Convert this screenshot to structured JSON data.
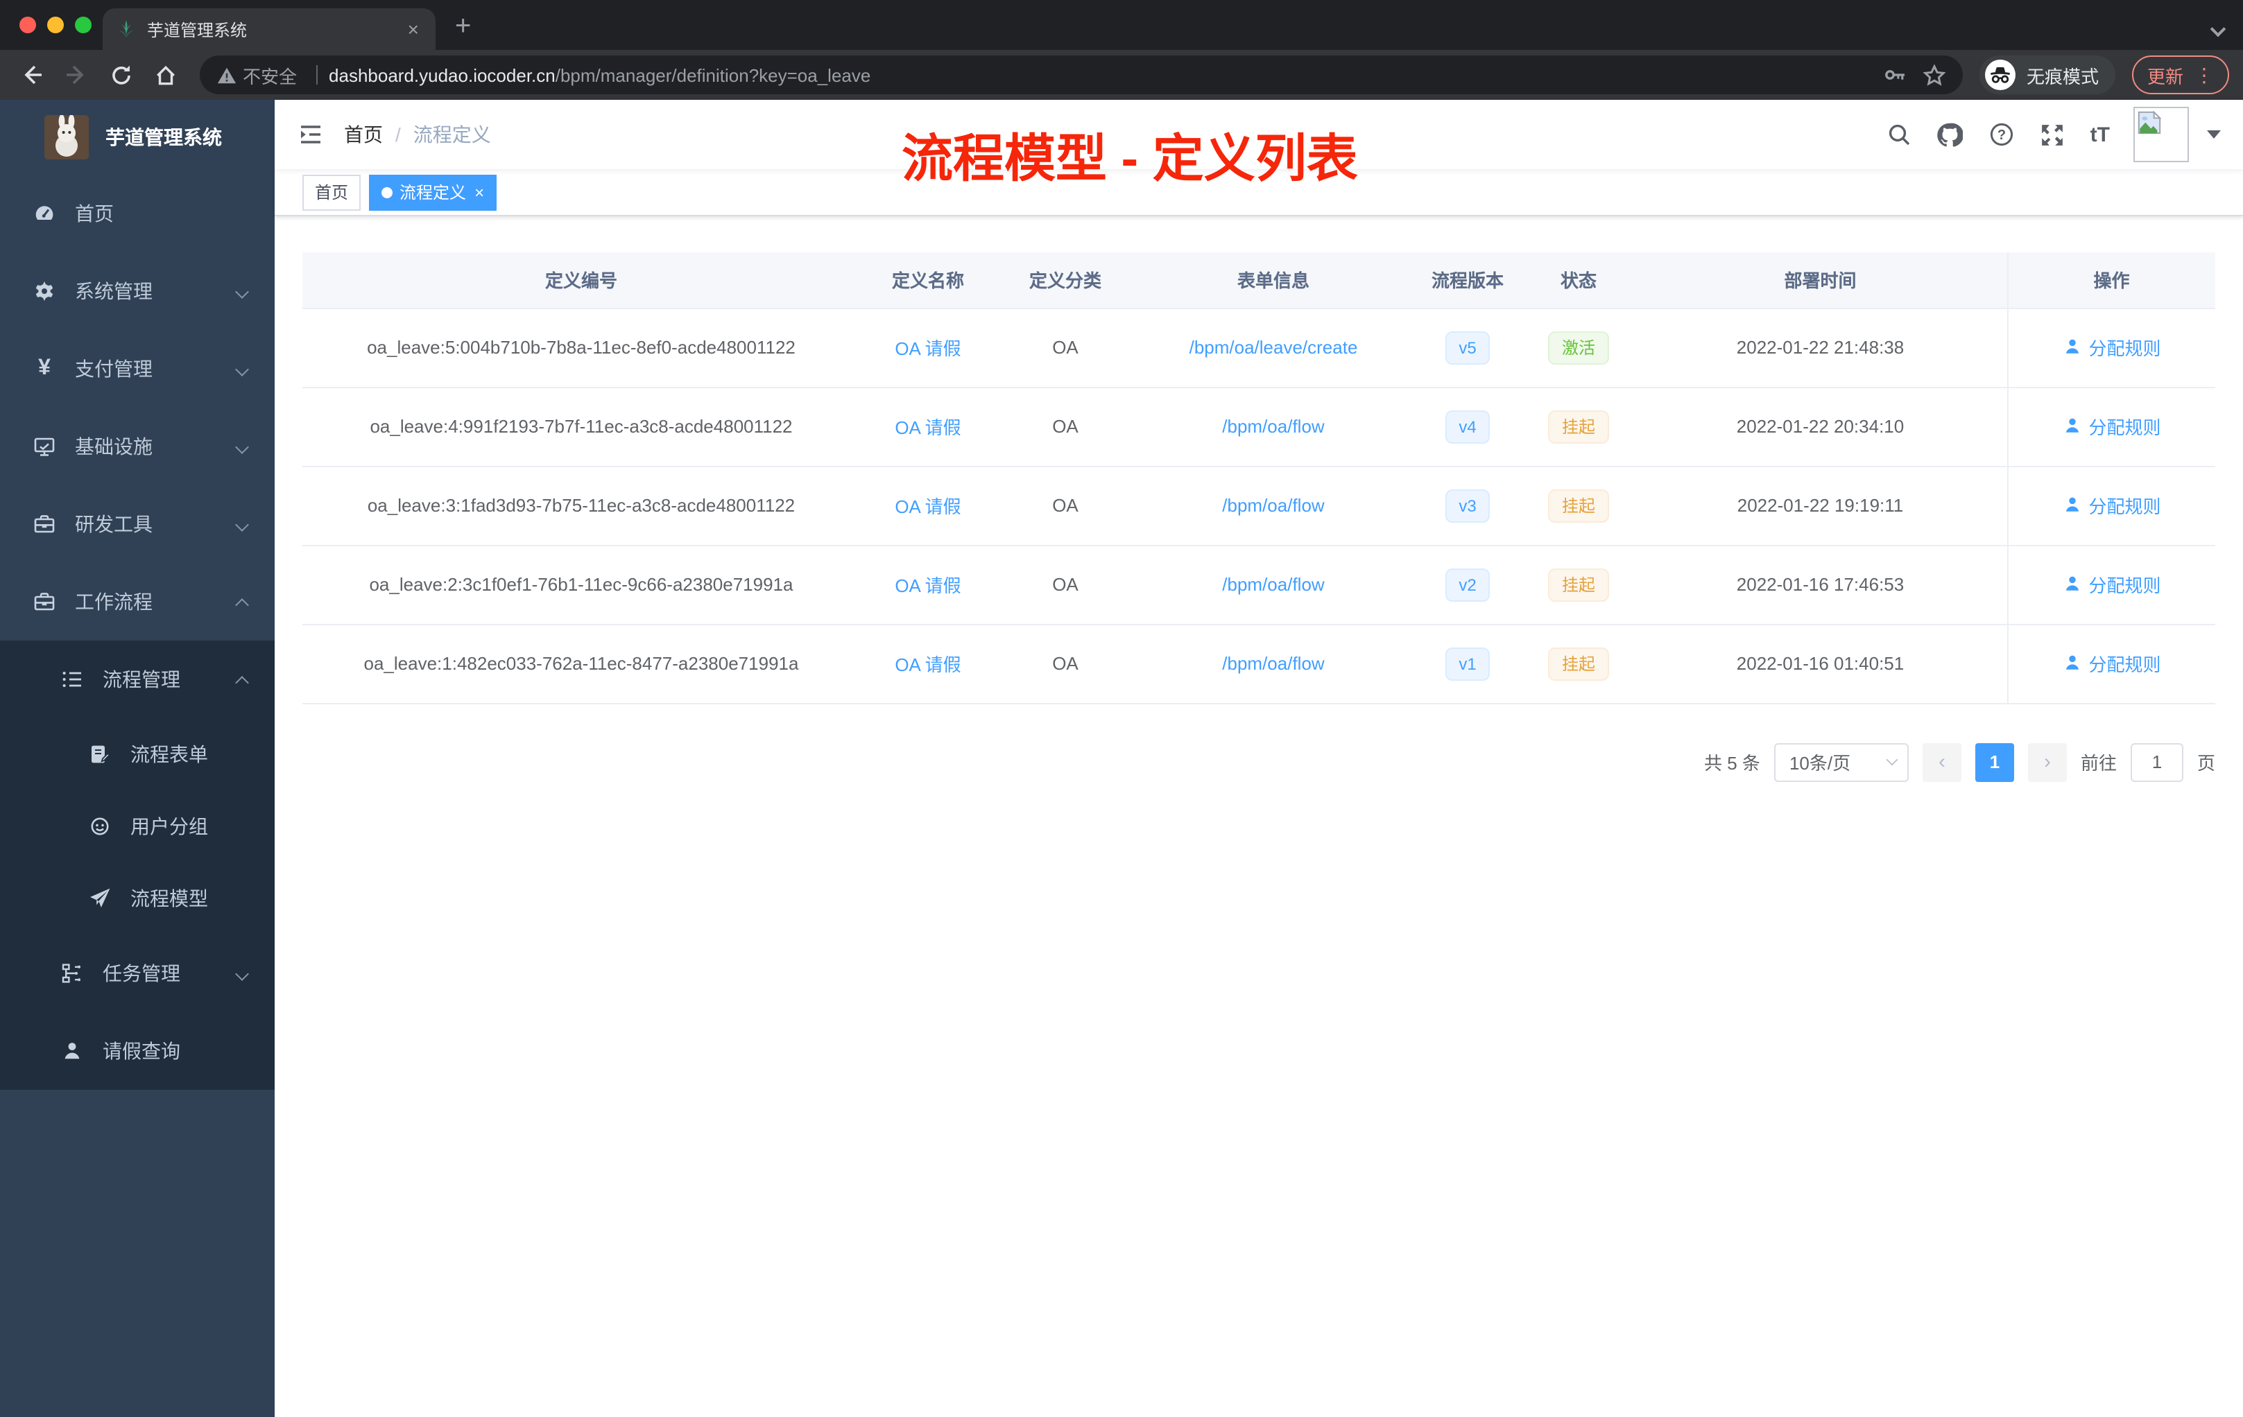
{
  "browser": {
    "tab": {
      "title": "芋道管理系统",
      "close_label": "×",
      "new_tab_label": "+"
    },
    "toolbar": {
      "security_label": "不安全",
      "url_host": "dashboard.yudao.iocoder.cn",
      "url_path": "/bpm/manager/definition?key=oa_leave",
      "incognito_label": "无痕模式",
      "update_label": "更新",
      "menu_dots": "⋮"
    }
  },
  "sidebar": {
    "app_title": "芋道管理系统",
    "menu": [
      {
        "label": "首页",
        "icon": "dashboard-icon"
      },
      {
        "label": "系统管理",
        "icon": "gear-icon"
      },
      {
        "label": "支付管理",
        "icon": "yen-icon"
      },
      {
        "label": "基础设施",
        "icon": "monitor-icon"
      },
      {
        "label": "研发工具",
        "icon": "toolbox-icon"
      },
      {
        "label": "工作流程",
        "icon": "toolbox-icon"
      }
    ],
    "submenu": {
      "process_management": "流程管理",
      "items": [
        {
          "label": "流程表单",
          "icon": "form-icon"
        },
        {
          "label": "用户分组",
          "icon": "face-icon"
        },
        {
          "label": "流程模型",
          "icon": "paper-plane-icon"
        }
      ],
      "task_management": "任务管理",
      "leave_query": "请假查询"
    }
  },
  "navbar": {
    "breadcrumb_home": "首页",
    "breadcrumb_sep": "/",
    "breadcrumb_current": "流程定义",
    "font_size_label": "tT"
  },
  "annotation": {
    "text": "流程模型 - 定义列表",
    "color": "#F5260A"
  },
  "tags": {
    "home": "首页",
    "active": "流程定义",
    "close_label": "×"
  },
  "table": {
    "columns": [
      "定义编号",
      "定义名称",
      "定义分类",
      "表单信息",
      "流程版本",
      "状态",
      "部署时间",
      "操作"
    ],
    "action_label": "分配规则",
    "rows": [
      {
        "id": "oa_leave:5:004b710b-7b8a-11ec-8ef0-acde48001122",
        "name": "OA 请假",
        "category": "OA",
        "form": "/bpm/oa/leave/create",
        "version": "v5",
        "status": "激活",
        "status_color": "#67C23A",
        "time": "2022-01-22 21:48:38"
      },
      {
        "id": "oa_leave:4:991f2193-7b7f-11ec-a3c8-acde48001122",
        "name": "OA 请假",
        "category": "OA",
        "form": "/bpm/oa/flow",
        "version": "v4",
        "status": "挂起",
        "status_color": "#E6A23C",
        "time": "2022-01-22 20:34:10"
      },
      {
        "id": "oa_leave:3:1fad3d93-7b75-11ec-a3c8-acde48001122",
        "name": "OA 请假",
        "category": "OA",
        "form": "/bpm/oa/flow",
        "version": "v3",
        "status": "挂起",
        "status_color": "#E6A23C",
        "time": "2022-01-22 19:19:11"
      },
      {
        "id": "oa_leave:2:3c1f0ef1-76b1-11ec-9c66-a2380e71991a",
        "name": "OA 请假",
        "category": "OA",
        "form": "/bpm/oa/flow",
        "version": "v2",
        "status": "挂起",
        "status_color": "#E6A23C",
        "time": "2022-01-16 17:46:53"
      },
      {
        "id": "oa_leave:1:482ec033-762a-11ec-8477-a2380e71991a",
        "name": "OA 请假",
        "category": "OA",
        "form": "/bpm/oa/flow",
        "version": "v1",
        "status": "挂起",
        "status_color": "#E6A23C",
        "time": "2022-01-16 01:40:51"
      }
    ]
  },
  "pagination": {
    "total": "共 5 条",
    "page_size": "10条/页",
    "prev": "‹",
    "page": "1",
    "next": "›",
    "goto_label": "前往",
    "goto_value": "1",
    "page_unit": "页"
  },
  "colors": {
    "primary": "#409EFF",
    "success": "#67C23A",
    "warning": "#E6A23C",
    "sidebar_bg": "#304156",
    "submenu_bg": "#1F2D3D",
    "annotation": "#F5260A"
  }
}
